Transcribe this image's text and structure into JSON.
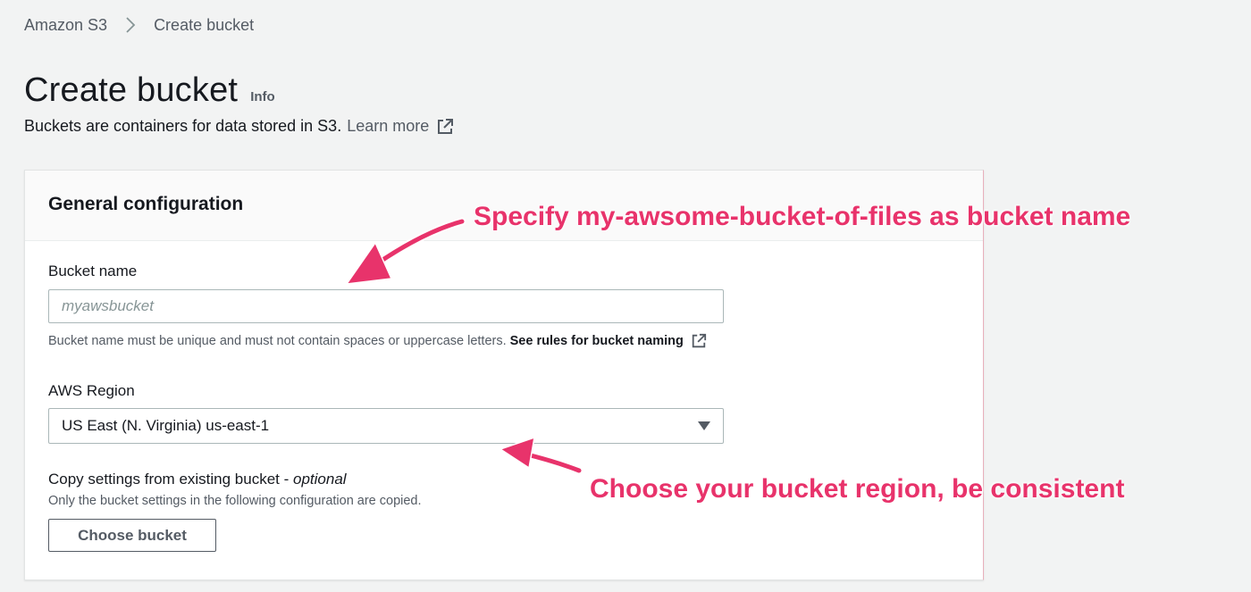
{
  "breadcrumb": {
    "root": "Amazon S3",
    "current": "Create bucket"
  },
  "header": {
    "title": "Create bucket",
    "info_label": "Info",
    "description": "Buckets are containers for data stored in S3.",
    "learn_more": "Learn more"
  },
  "general_config": {
    "title": "General configuration",
    "bucket_name": {
      "label": "Bucket name",
      "value": "",
      "placeholder": "myawsbucket",
      "hint": "Bucket name must be unique and must not contain spaces or uppercase letters.",
      "rules_link": "See rules for bucket naming"
    },
    "region": {
      "label": "AWS Region",
      "selected": "US East (N. Virginia) us-east-1"
    },
    "copy_settings": {
      "label": "Copy settings from existing bucket -",
      "optional": "optional",
      "description": "Only the bucket settings in the following configuration are copied.",
      "button": "Choose bucket"
    }
  },
  "annotations": {
    "bucket_name_note": "Specify my-awsome-bucket-of-files as bucket name",
    "region_note": "Choose your bucket region, be consistent",
    "color": "#e8336b"
  },
  "icons": {
    "breadcrumb_separator": "chevron-right-icon",
    "external_link": "external-link-icon",
    "dropdown_caret": "caret-down-icon"
  }
}
